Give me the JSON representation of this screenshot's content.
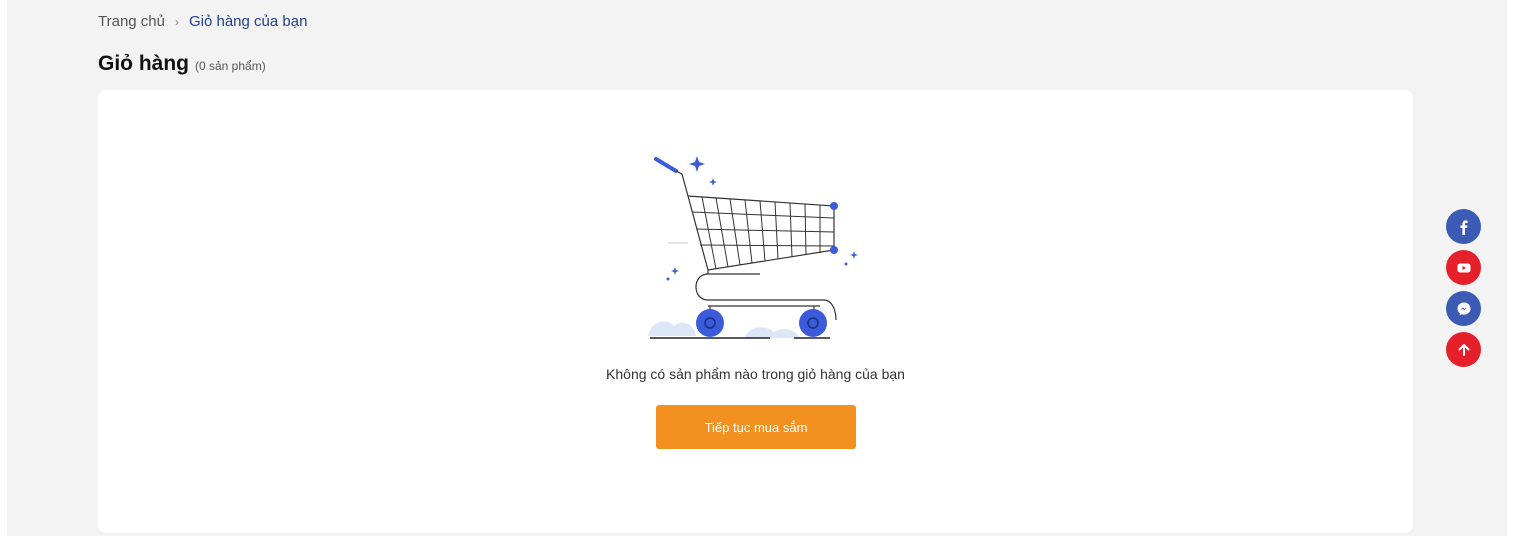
{
  "breadcrumb": {
    "home": "Trang chủ",
    "separator": "›",
    "current": "Giỏ hàng của bạn"
  },
  "header": {
    "title": "Giỏ hàng",
    "count": "(0 sản phẩm)"
  },
  "cart": {
    "empty_message": "Không có sản phẩm nào trong giỏ hàng của bạn",
    "continue_label": "Tiếp tục mua sắm",
    "illustration_icon": "empty-cart-illustration"
  },
  "social": [
    {
      "name": "facebook-icon",
      "color": "#3b5bb5"
    },
    {
      "name": "youtube-icon",
      "color": "#e5202b"
    },
    {
      "name": "messenger-icon",
      "color": "#3b5bb5"
    },
    {
      "name": "scroll-top-icon",
      "color": "#e5202b"
    }
  ],
  "colors": {
    "accent": "#f29120",
    "brand_blue": "#3b5bdb",
    "breadcrumb_current": "#1f3f8f"
  }
}
